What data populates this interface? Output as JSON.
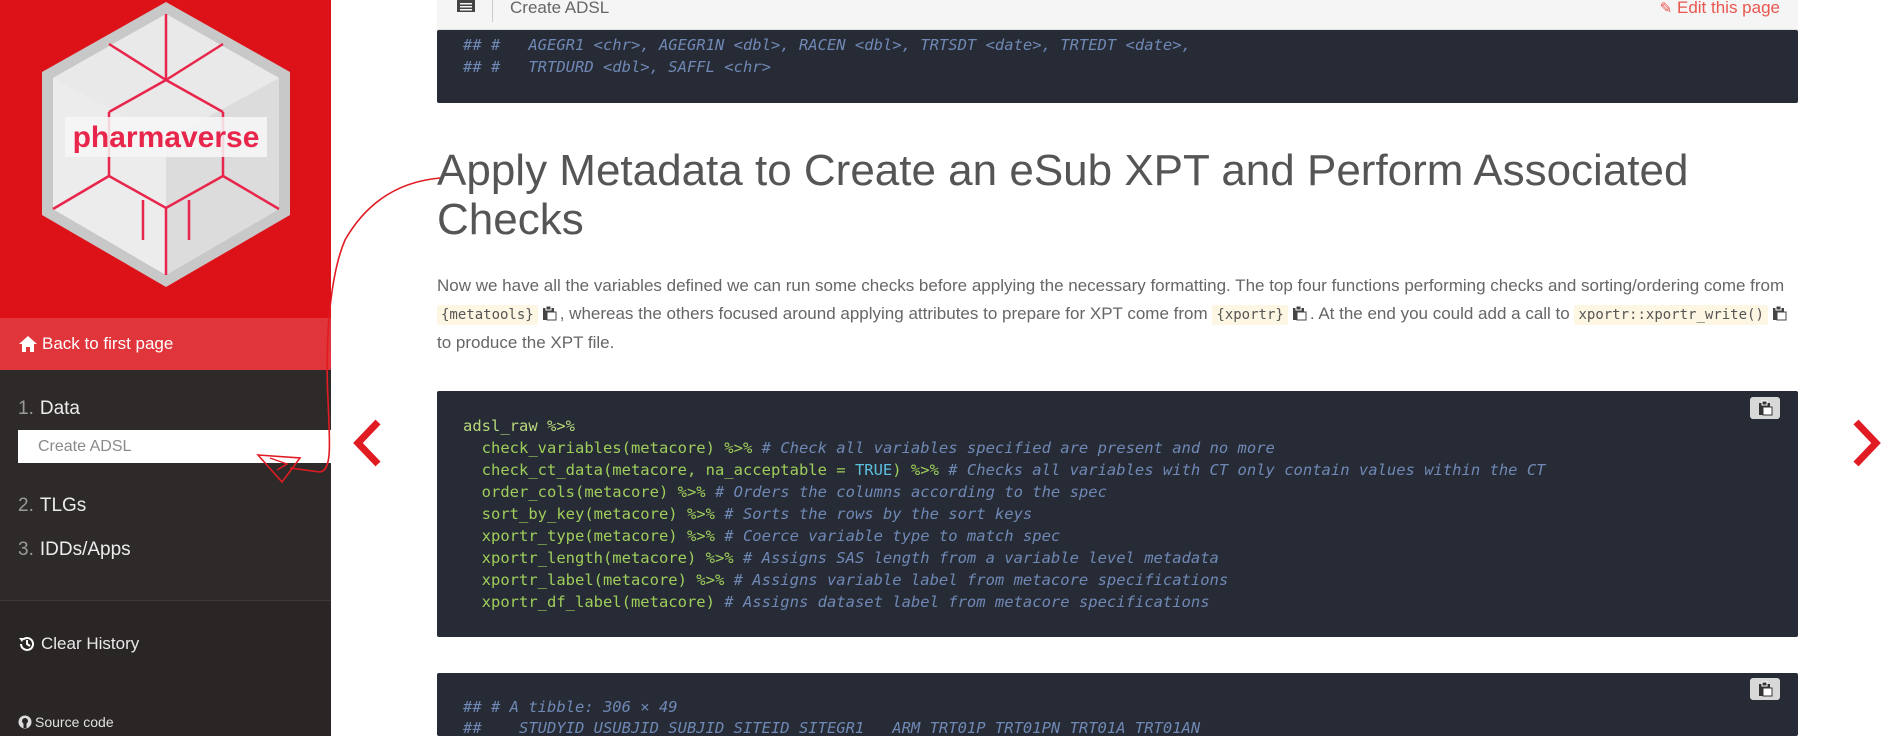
{
  "sidebar": {
    "logo_text": "pharmaverse",
    "back_label": "Back to first page",
    "nav": [
      {
        "num": "1.",
        "label": "Data"
      },
      {
        "num": "2.",
        "label": "TLGs"
      },
      {
        "num": "3.",
        "label": "IDDs/Apps"
      }
    ],
    "sub_item": "Create ADSL",
    "clear_history": "Clear History",
    "source_code": "Source code"
  },
  "topbar": {
    "title": "Create ADSL",
    "edit_label": "Edit this page"
  },
  "code_top": {
    "lines": [
      "## #   AGEGR1 <chr>, AGEGR1N <dbl>, RACEN <dbl>, TRTSDT <date>, TRTEDT <date>,",
      "## #   TRTDURD <dbl>, SAFFL <chr>"
    ]
  },
  "main": {
    "heading": "Apply Metadata to Create an eSub XPT and Perform Associated Checks",
    "para_1": "Now we have all the variables defined we can run some checks before applying the necessary formatting. The top four functions performing checks and sorting/ordering come from",
    "code_metatools": "{metatools}",
    "para_2": ", whereas the others focused around applying attributes to prepare for XPT come from",
    "code_xportr": "{xportr}",
    "para_3": ". At the end you could add a call to",
    "code_write": "xportr::xportr_write()",
    "para_4": "to produce the XPT file."
  },
  "code_main": {
    "l0": "adsl_raw %>%",
    "l1_fn": "  check_variables(metacore) %>%",
    "l1_cm": " # Check all variables specified are present and no more",
    "l2_fn": "  check_ct_data(metacore, na_acceptable = ",
    "l2_kw": "TRUE",
    "l2_fn2": ") %>%",
    "l2_cm": " # Checks all variables with CT only contain values within the CT",
    "l3_fn": "  order_cols(metacore) %>%",
    "l3_cm": " # Orders the columns according to the spec",
    "l4_fn": "  sort_by_key(metacore) %>%",
    "l4_cm": " # Sorts the rows by the sort keys",
    "l5_fn": "  xportr_type(metacore) %>%",
    "l5_cm": " # Coerce variable type to match spec",
    "l6_fn": "  xportr_length(metacore) %>%",
    "l6_cm": " # Assigns SAS length from a variable level metadata",
    "l7_fn": "  xportr_label(metacore) %>%",
    "l7_cm": " # Assigns variable label from metacore specifications",
    "l8_fn": "  xportr_df_label(metacore)",
    "l8_cm": " # Assigns dataset label from metacore specifications"
  },
  "code_bottom": {
    "lines": [
      "## # A tibble: 306 × 49",
      "##    STUDYID USUBJID SUBJID SITEID SITEGR1   ARM TRT01P TRT01PN TRT01A TRT01AN"
    ]
  },
  "colors": {
    "sidebar_red": "#dd1118",
    "accent_link": "#e8564f",
    "code_bg": "#272b35",
    "sidebar_dark": "#2b2626"
  }
}
